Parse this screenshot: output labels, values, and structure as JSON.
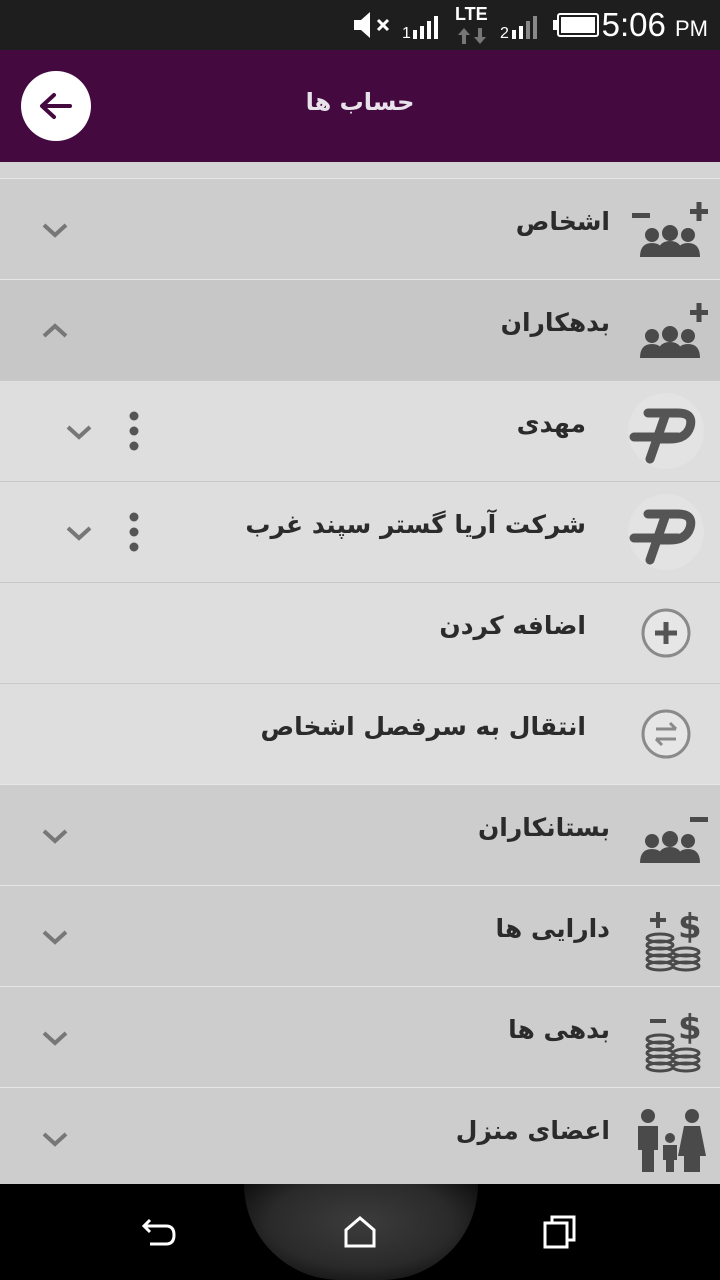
{
  "status_bar": {
    "time": "5:06",
    "ampm": "PM",
    "network": "LTE"
  },
  "app_bar": {
    "title": "حساب ها"
  },
  "list": {
    "groups": [
      {
        "label": "اشخاص",
        "icon": "people-add-remove-icon",
        "expanded": false
      },
      {
        "label": "بدهکاران",
        "icon": "people-add-icon",
        "expanded": true
      },
      {
        "label": "بستانکاران",
        "icon": "people-remove-icon",
        "expanded": false
      },
      {
        "label": "دارایی ها",
        "icon": "coins-plus-icon",
        "expanded": false
      },
      {
        "label": "بدهی ها",
        "icon": "coins-minus-icon",
        "expanded": false
      },
      {
        "label": "اعضای منزل",
        "icon": "family-icon",
        "expanded": false
      }
    ],
    "debtors": [
      {
        "label": "مهدی",
        "icon": "account-logo-icon"
      },
      {
        "label": "شرکت آریا گستر سپند غرب",
        "icon": "account-logo-icon"
      }
    ],
    "actions": [
      {
        "label": "اضافه کردن",
        "icon": "add-circle-icon"
      },
      {
        "label": "انتقال به سرفصل اشخاص",
        "icon": "transfer-circle-icon"
      }
    ]
  },
  "colors": {
    "app_bar": "#440a40",
    "status_bar": "#1e1e1e",
    "group_row": "#cdcdcd",
    "child_row": "#dedede"
  }
}
